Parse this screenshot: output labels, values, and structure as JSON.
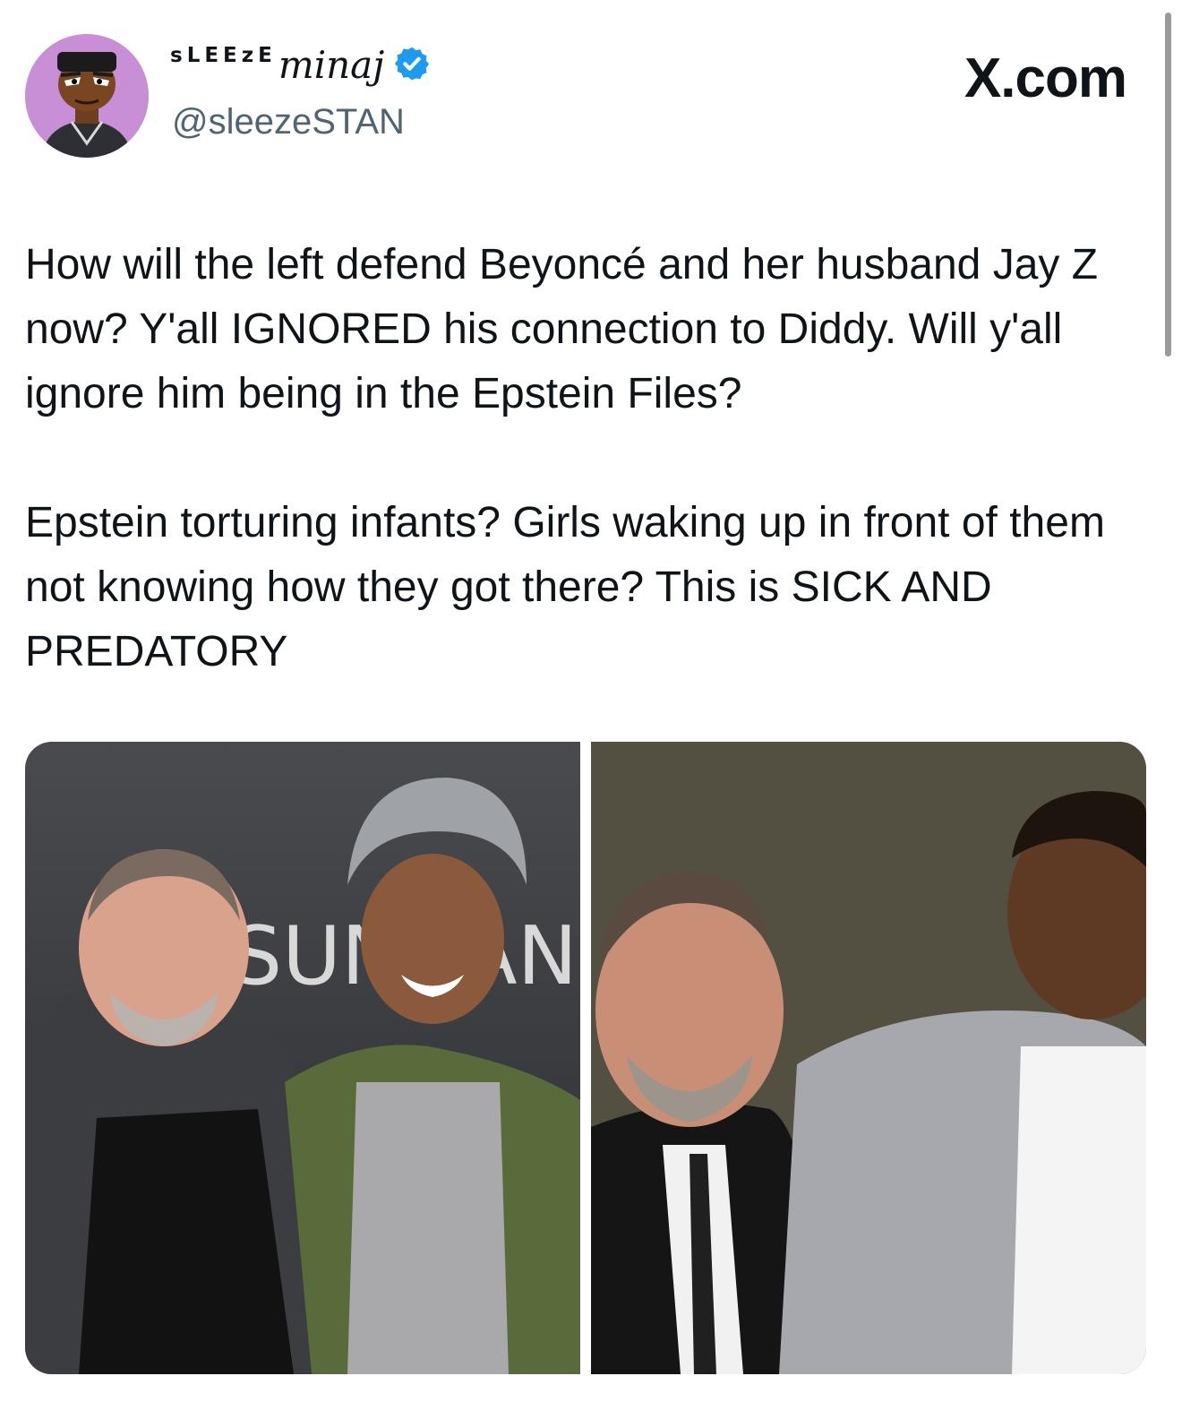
{
  "author": {
    "name_caps": "sLEEzE",
    "name_script": "minaj",
    "handle": "@sleezeSTAN",
    "avatar_icon": "cartoon-avatar-icon",
    "avatar_bg": "#c98fd6",
    "verified_icon": "verified-badge-icon",
    "verified_color": "#1d9bf0"
  },
  "site": {
    "label": "X.com"
  },
  "tweet": {
    "paragraph_1": "How will the left defend Beyoncé and her husband Jay Z now? Y'all IGNORED his connection to Diddy. Will y'all ignore him being in the Epstein Files?",
    "paragraph_2": "Epstein torturing infants? Girls waking up in front of them not knowing how they got there? This is SICK AND PREDATORY"
  },
  "media": {
    "photos": [
      {
        "backdrop_text": "SUNDANCE FILM FESTIVAL"
      },
      {
        "backdrop_text": ""
      }
    ]
  },
  "colors": {
    "text": "#0f1419",
    "secondary": "#536471",
    "accent": "#1d9bf0"
  }
}
